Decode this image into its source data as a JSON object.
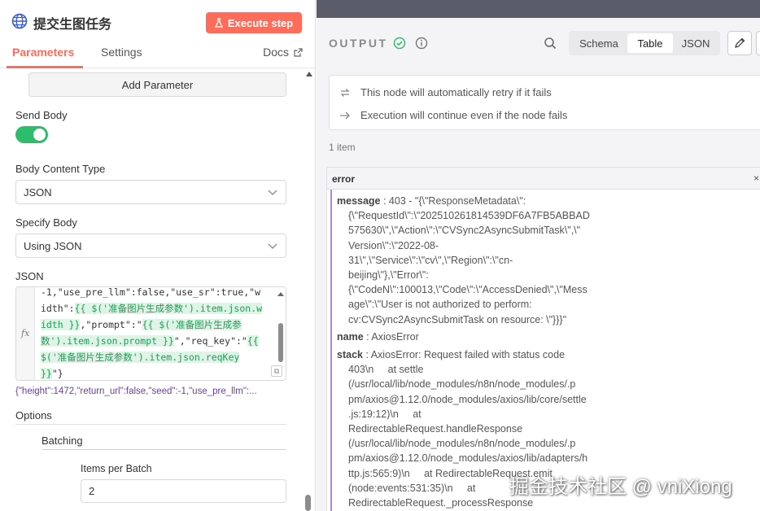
{
  "node": {
    "title": "提交生图任务",
    "execute_label": "Execute step"
  },
  "tabs": {
    "parameters": "Parameters",
    "settings": "Settings",
    "docs": "Docs"
  },
  "params": {
    "add_parameter": "Add Parameter",
    "send_body_label": "Send Body",
    "send_body_on": true,
    "body_content_type_label": "Body Content Type",
    "body_content_type_value": "JSON",
    "specify_body_label": "Specify Body",
    "specify_body_value": "Using JSON",
    "json_label": "JSON",
    "json_code_lines": [
      "-1,\"use_pre_llm\":false,\"use_sr\":true,\"w",
      "idth\":",
      "{{ $('准备图片生成参数').item.json.w",
      "idth }}",
      ",\"prompt\":\"",
      "{{ $('准备图片生成参",
      "数').item.json.prompt }}",
      "\",\"req_key\":\"",
      "{{",
      "$('准备图片生成参数').item.json.reqKey",
      "}}",
      "\"}"
    ],
    "json_preview": "{\"height\":1472,\"return_url\":false,\"seed\":-1,\"use_pre_llm\":...",
    "options_label": "Options",
    "batching_label": "Batching",
    "items_per_batch_label": "Items per Batch",
    "items_per_batch_value": "2"
  },
  "output": {
    "label": "OUTPUT",
    "views": [
      "Schema",
      "Table",
      "JSON"
    ],
    "active_view": "Table",
    "notices": [
      "This node will automatically retry if it fails",
      "Execution will continue even if the node fails"
    ],
    "items_count": "1 item",
    "column": "error",
    "message_key": "message",
    "message_lines": [
      " : 403 - \"{\\\"ResponseMetadata\\\":",
      "{\\\"RequestId\\\":\\\"202510261814539DF6A7FB5ABBAD",
      "575630\\\",\\\"Action\\\":\\\"CVSync2AsyncSubmitTask\\\",\\\"",
      "Version\\\":\\\"2022-08-",
      "31\\\",\\\"Service\\\":\\\"cv\\\",\\\"Region\\\":\\\"cn-",
      "beijing\\\"},\\\"Error\\\":",
      "{\\\"CodeN\\\":100013,\\\"Code\\\":\\\"AccessDenied\\\",\\\"Mess",
      "age\\\":\\\"User is not authorized to perform:",
      "cv:CVSync2AsyncSubmitTask on resource: \\\"}}}\""
    ],
    "name_key": "name",
    "name_value": " : AxiosError",
    "stack_key": "stack",
    "stack_first": " : AxiosError: Request failed with status code",
    "stack_lines": [
      "403\\n     at settle",
      "(/usr/local/lib/node_modules/n8n/node_modules/.p",
      "pm/axios@1.12.0/node_modules/axios/lib/core/settle",
      ".js:19:12)\\n     at",
      "RedirectableRequest.handleResponse",
      "(/usr/local/lib/node_modules/n8n/node_modules/.p",
      "pm/axios@1.12.0/node_modules/axios/lib/adapters/h",
      "ttp.js:565:9)\\n     at RedirectableRequest.emit",
      "(node:events:531:35)\\n     at",
      "RedirectableRequest._processResponse"
    ]
  },
  "watermark": "掘金技术社区 @ vniXiong",
  "colors": {
    "accent": "#ff6d5a",
    "toggle_on": "#2ebd6b",
    "success": "#2ebd6b",
    "expression": "#1f9d55",
    "preview_text": "#6b3fa0"
  }
}
